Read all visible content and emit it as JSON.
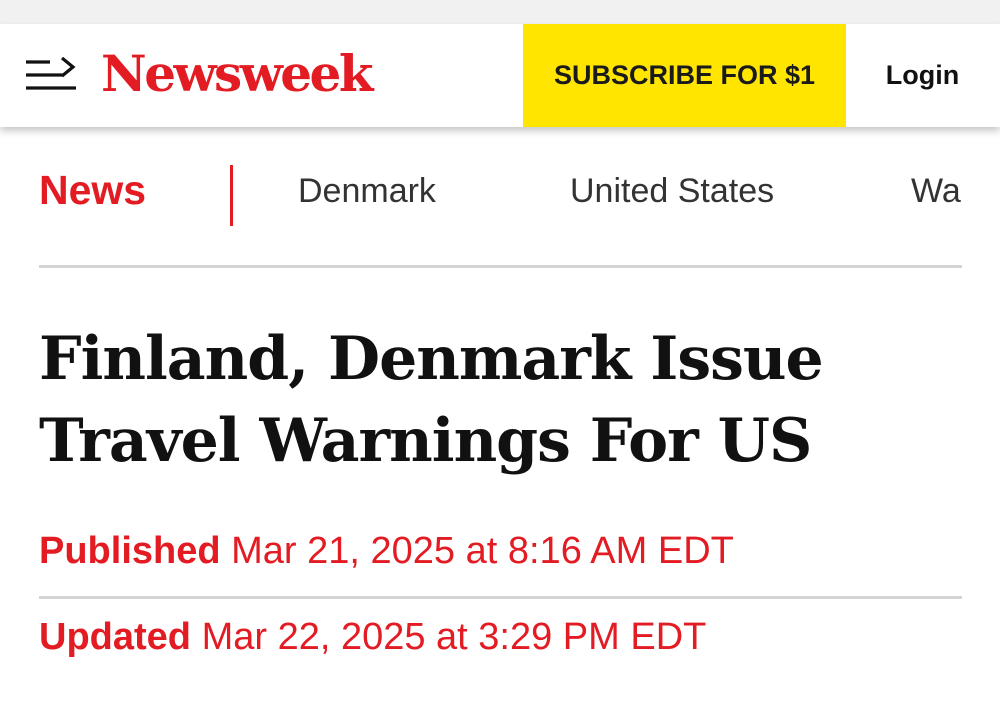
{
  "header": {
    "logo_text": "Newsweek",
    "subscribe_label": "SUBSCRIBE FOR $1",
    "login_label": "Login",
    "menu_icon": "menu-arrow-icon"
  },
  "subnav": {
    "active": "News",
    "links": [
      "Denmark",
      "United States",
      "Wa"
    ]
  },
  "article": {
    "headline": "Finland, Denmark Issue Travel Warnings For US",
    "published_label": "Published",
    "published_value": "Mar 21, 2025 at 8:16 AM EDT",
    "updated_label": "Updated",
    "updated_value": "Mar 22, 2025 at 3:29 PM EDT"
  },
  "colors": {
    "brand_red": "#e31b23",
    "subscribe_yellow": "#ffe500"
  }
}
